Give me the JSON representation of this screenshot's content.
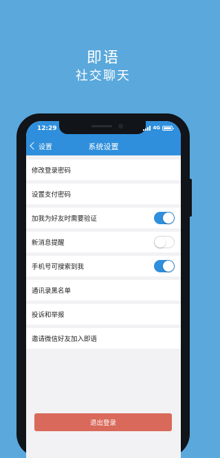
{
  "promo": {
    "title": "即语",
    "subtitle": "社交聊天"
  },
  "status_bar": {
    "time": "12:29",
    "network": "4G"
  },
  "nav": {
    "back_label": "设置",
    "title": "系统设置"
  },
  "settings": [
    {
      "label": "修改登录密码",
      "type": "link"
    },
    {
      "label": "设置支付密码",
      "type": "link"
    },
    {
      "label": "加我为好友时需要验证",
      "type": "toggle",
      "on": true
    },
    {
      "label": "新消息提醒",
      "type": "toggle",
      "on": false
    },
    {
      "label": "手机号可搜索到我",
      "type": "toggle",
      "on": true
    },
    {
      "label": "通讯录黑名单",
      "type": "link"
    },
    {
      "label": "投诉和举报",
      "type": "link"
    },
    {
      "label": "邀请微信好友加入即语",
      "type": "link"
    }
  ],
  "logout_label": "退出登录",
  "colors": {
    "background": "#5aa8dc",
    "accent": "#2f8fdc",
    "danger": "#d9695a"
  }
}
